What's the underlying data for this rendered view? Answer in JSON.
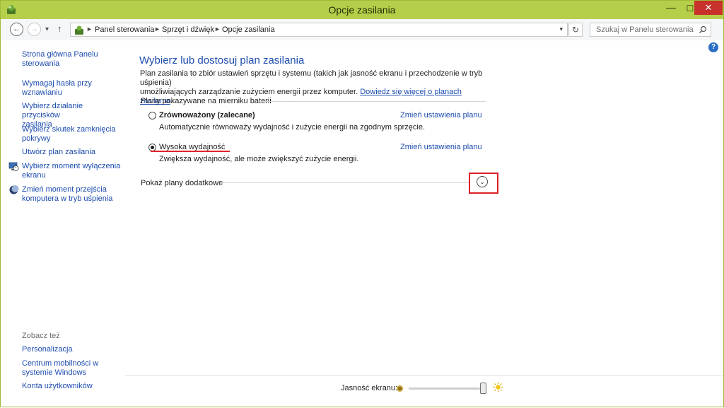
{
  "window": {
    "title": "Opcje zasilania",
    "minimize_glyph": "—",
    "maximize_glyph": "☐",
    "close_glyph": "✕"
  },
  "toolbar": {
    "back_icon": "arrow-left-icon",
    "forward_icon": "arrow-right-icon",
    "recent_icon": "chevron-down-icon",
    "up_icon": "arrow-up-icon",
    "breadcrumbs": [
      "Panel sterowania",
      "Sprzęt i dźwięk",
      "Opcje zasilania"
    ],
    "search_placeholder": "Szukaj w Panelu sterowania"
  },
  "sidebar": {
    "items": [
      {
        "label_lines": [
          "Strona główna Panelu",
          "sterowania"
        ],
        "icon": ""
      },
      {
        "label_lines": [
          "Wymagaj hasła przy",
          "wznawianiu"
        ],
        "icon": ""
      },
      {
        "label_lines": [
          "Wybierz działanie przycisków",
          "zasilania"
        ],
        "icon": ""
      },
      {
        "label_lines": [
          "Wybierz skutek zamknięcia",
          "pokrywy"
        ],
        "icon": ""
      },
      {
        "label_lines": [
          "Utwórz plan zasilania"
        ],
        "icon": ""
      },
      {
        "label_lines": [
          "Wybierz moment wyłączenia",
          "ekranu"
        ],
        "icon": "monitor-clock-icon"
      },
      {
        "label_lines": [
          "Zmień moment przejścia",
          "komputera w tryb uśpienia"
        ],
        "icon": "moon-icon"
      }
    ],
    "see_also_title": "Zobacz też",
    "see_also": [
      {
        "label_lines": [
          "Personalizacja"
        ]
      },
      {
        "label_lines": [
          "Centrum mobilności w",
          "systemie Windows"
        ]
      },
      {
        "label_lines": [
          "Konta użytkowników"
        ]
      }
    ]
  },
  "main": {
    "title": "Wybierz lub dostosuj plan zasilania",
    "description_line1": "Plan zasilania to zbiór ustawień sprzętu i systemu (takich jak jasność ekranu i przechodzenie w tryb uśpienia)",
    "description_line2": "umożliwiających zarządzanie zużyciem energii przez komputer. ",
    "description_link": "Dowiedz się więcej o planach zasilania",
    "description_end": ".",
    "section_title": "Plany pokazywane na mierniku baterii",
    "plans": [
      {
        "name": "Zrównoważony (zalecane)",
        "description": "Automatycznie równoważy wydajność i zużycie energii na zgodnym sprzęcie.",
        "change_label": "Zmień ustawienia planu",
        "selected": false
      },
      {
        "name": "Wysoka wydajność",
        "description": "Zwiększa wydajność, ale może zwiększyć zużycie energii.",
        "change_label": "Zmień ustawienia planu",
        "selected": true
      }
    ],
    "show_more_label": "Pokaż plany dodatkowe",
    "expand_glyph": "⌄",
    "help_glyph": "?"
  },
  "bottom": {
    "brightness_label": "Jasność ekranu:",
    "brightness_level": 1.0
  },
  "colors": {
    "titlebar": "#b5cf4a",
    "link": "#1c4cae",
    "close": "#c7302b",
    "highlight": "#dd1f26"
  }
}
